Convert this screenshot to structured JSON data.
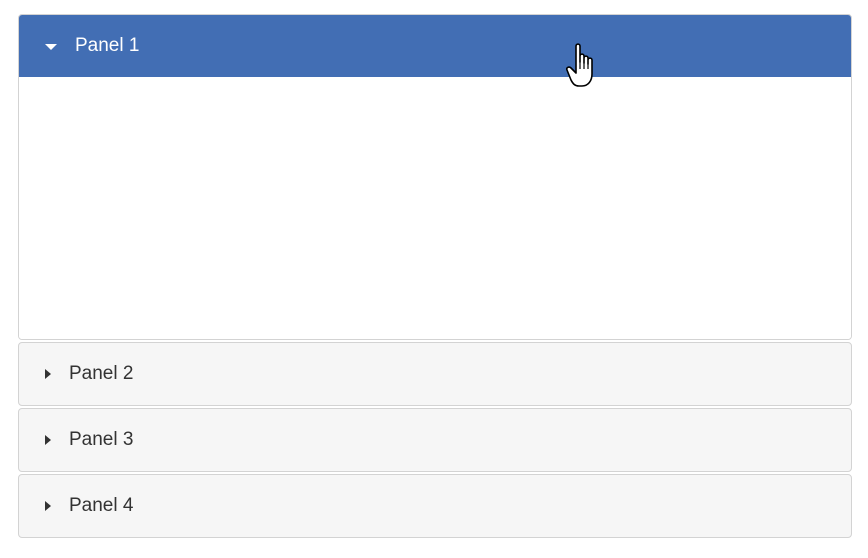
{
  "accordion": {
    "panels": [
      {
        "label": "Panel 1",
        "expanded": true,
        "icon": "caret-down-icon"
      },
      {
        "label": "Panel 2",
        "expanded": false,
        "icon": "caret-right-icon"
      },
      {
        "label": "Panel 3",
        "expanded": false,
        "icon": "caret-right-icon"
      },
      {
        "label": "Panel 4",
        "expanded": false,
        "icon": "caret-right-icon"
      }
    ]
  },
  "colors": {
    "active_header": "#426eb4",
    "inactive_header": "#f6f6f6",
    "border": "#d3d3d3",
    "text": "#333333"
  },
  "cursor": {
    "icon": "hand-pointer-icon"
  }
}
